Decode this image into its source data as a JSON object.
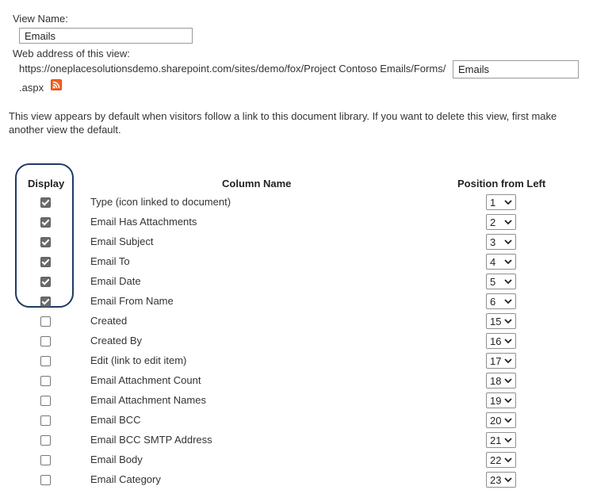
{
  "view_name": {
    "label": "View Name:",
    "value": "Emails"
  },
  "web_address": {
    "label": "Web address of this view:",
    "url_prefix": "https://oneplacesolutionsdemo.sharepoint.com/sites/demo/fox/Project Contoso Emails/Forms/",
    "value": "Emails",
    "suffix": ".aspx",
    "feed_icon": "rss-feed-icon"
  },
  "description": "This view appears by default when visitors follow a link to this document library. If you want to delete this view, first make another view the default.",
  "columns_table": {
    "headers": {
      "display": "Display",
      "column_name": "Column Name",
      "position": "Position from Left"
    },
    "rows": [
      {
        "checked": true,
        "name": "Type (icon linked to document)",
        "position": "1"
      },
      {
        "checked": true,
        "name": "Email Has Attachments",
        "position": "2"
      },
      {
        "checked": true,
        "name": "Email Subject",
        "position": "3"
      },
      {
        "checked": true,
        "name": "Email To",
        "position": "4"
      },
      {
        "checked": true,
        "name": "Email Date",
        "position": "5"
      },
      {
        "checked": true,
        "name": "Email From Name",
        "position": "6"
      },
      {
        "checked": false,
        "name": "Created",
        "position": "15"
      },
      {
        "checked": false,
        "name": "Created By",
        "position": "16"
      },
      {
        "checked": false,
        "name": "Edit (link to edit item)",
        "position": "17"
      },
      {
        "checked": false,
        "name": "Email Attachment Count",
        "position": "18"
      },
      {
        "checked": false,
        "name": "Email Attachment Names",
        "position": "19"
      },
      {
        "checked": false,
        "name": "Email BCC",
        "position": "20"
      },
      {
        "checked": false,
        "name": "Email BCC SMTP Address",
        "position": "21"
      },
      {
        "checked": false,
        "name": "Email Body",
        "position": "22"
      },
      {
        "checked": false,
        "name": "Email Category",
        "position": "23"
      }
    ]
  },
  "colors": {
    "highlight_border": "#1f3a63",
    "rss_orange": "#f26522",
    "checkbox_checked": "#6b6b6b"
  }
}
